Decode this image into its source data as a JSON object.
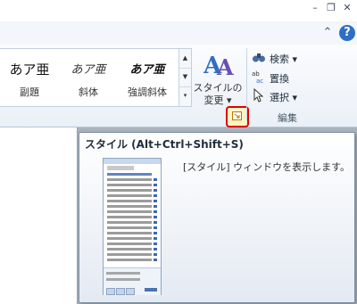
{
  "window": {
    "minimize_glyph": "–",
    "restore_glyph": "❐",
    "close_glyph": "✕"
  },
  "ribbon": {
    "minimize_glyph": "⌃",
    "help_glyph": "?",
    "style_gallery": [
      {
        "sample": "あア亜",
        "label": "副題"
      },
      {
        "sample": "あア亜",
        "label": "斜体"
      },
      {
        "sample": "あア亜",
        "label": "強調斜体"
      }
    ],
    "change_styles": {
      "line1": "スタイルの",
      "line2": "変更 ▾"
    },
    "editing": {
      "find": "検索 ▾",
      "replace": "置換",
      "select": "選択 ▾",
      "group_label": "編集"
    }
  },
  "tooltip": {
    "title": "スタイル (Alt+Ctrl+Shift+S)",
    "description": "[スタイル] ウィンドウを表示します。"
  },
  "colors": {
    "accent": "#2f6fc3",
    "highlight": "#e00000"
  }
}
